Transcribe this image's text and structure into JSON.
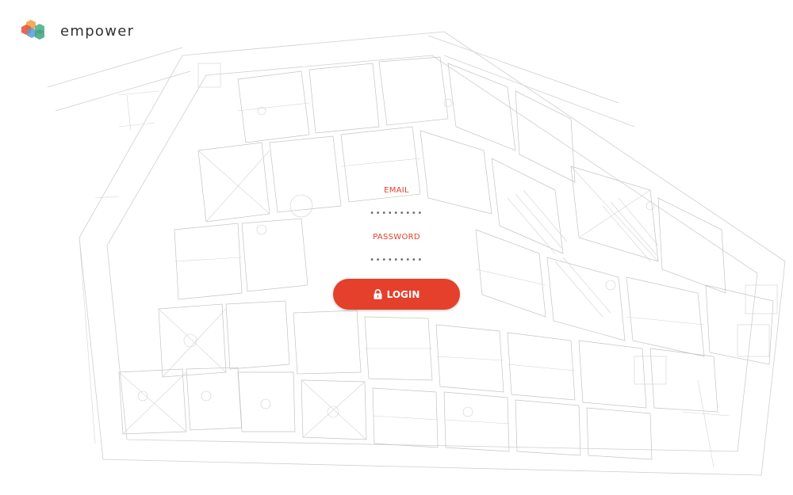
{
  "brand": {
    "name": "empower",
    "logo_icon": "hexagon-cluster-logo",
    "logo_colors": [
      "#e8563a",
      "#5b9bd5",
      "#4fb38f",
      "#f2a24a"
    ]
  },
  "form": {
    "email_label": "EMAIL",
    "email_placeholder": "•••••••••",
    "password_label": "PASSWORD",
    "password_placeholder": "•••••••••"
  },
  "login_button": {
    "label": "LOGIN",
    "icon": "lock-icon"
  },
  "colors": {
    "accent": "#e4402c",
    "background": "#ffffff",
    "sketch_lines": "#c8c8c8"
  }
}
